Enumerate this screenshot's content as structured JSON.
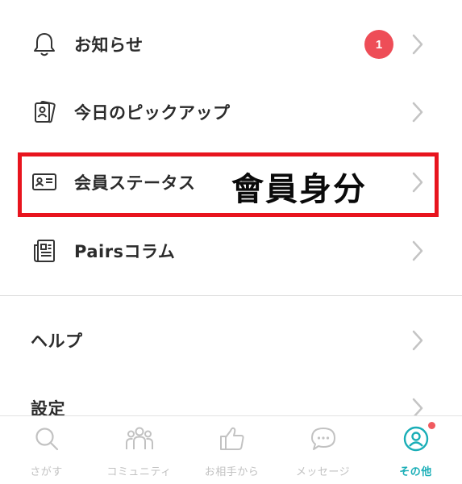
{
  "menu": {
    "notifications": {
      "label": "お知らせ",
      "badge": "1",
      "icon": "bell-icon"
    },
    "pickup": {
      "label": "今日のピックアップ",
      "icon": "profile-cards-icon"
    },
    "member_status": {
      "label": "会員ステータス",
      "icon": "id-card-icon"
    },
    "column": {
      "label": "Pairsコラム",
      "icon": "newspaper-icon"
    },
    "help": {
      "label": "ヘルプ"
    },
    "settings": {
      "label": "設定"
    }
  },
  "annotation": {
    "text": "會員身分",
    "box_color": "#e8141e"
  },
  "tabbar": {
    "tabs": [
      {
        "label": "さがす",
        "icon": "search-icon"
      },
      {
        "label": "コミュニティ",
        "icon": "community-icon"
      },
      {
        "label": "お相手から",
        "icon": "thumbs-up-icon"
      },
      {
        "label": "メッセージ",
        "icon": "message-icon"
      },
      {
        "label": "その他",
        "icon": "profile-icon",
        "active": true
      }
    ],
    "active_color": "#1aaeb7",
    "inactive_color": "#c2c2c2"
  },
  "colors": {
    "badge": "#ee4d57",
    "notify_dot": "#f05a5f"
  }
}
